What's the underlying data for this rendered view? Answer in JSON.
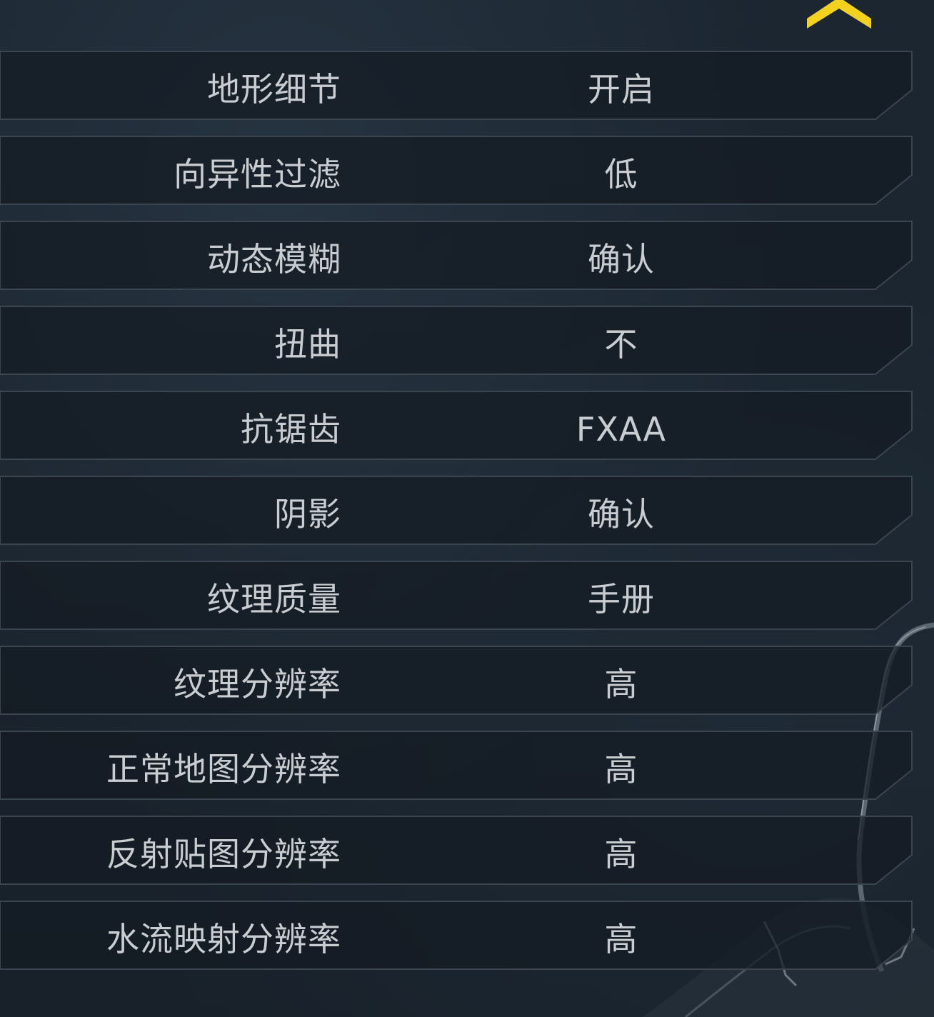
{
  "theme": {
    "accent": "#f2d21c",
    "text": "#c9cdd2",
    "row_bg": "#141b22",
    "row_border": "#3a4550"
  },
  "header": {
    "collapse_icon": "chevron-up-icon"
  },
  "settings": [
    {
      "label": "地形细节",
      "value": "开启"
    },
    {
      "label": "向异性过滤",
      "value": "低"
    },
    {
      "label": "动态模糊",
      "value": "确认"
    },
    {
      "label": "扭曲",
      "value": "不"
    },
    {
      "label": "抗锯齿",
      "value": "FXAA"
    },
    {
      "label": "阴影",
      "value": "确认"
    },
    {
      "label": "纹理质量",
      "value": "手册"
    },
    {
      "label": "纹理分辨率",
      "value": "高"
    },
    {
      "label": "正常地图分辨率",
      "value": "高"
    },
    {
      "label": "反射贴图分辨率",
      "value": "高"
    },
    {
      "label": "水流映射分辨率",
      "value": "高"
    }
  ]
}
